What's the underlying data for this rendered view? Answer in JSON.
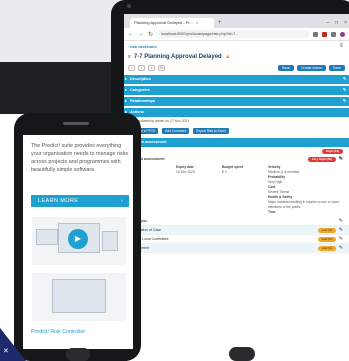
{
  "browser": {
    "tab_title": "Planning Approval Delayed - Pr...",
    "tab_close": "×",
    "new_tab": "+",
    "url": "localhost:8000/pro/lucas/page/risk.php?id=7..."
  },
  "app": {
    "logo": "risk decisions",
    "page_title": "7-7 Planning Approval Delayed",
    "toolbar_right": [
      "Save",
      "Create Action",
      "Save"
    ]
  },
  "sections": [
    "Description",
    "Categories",
    "Relationships",
    "Actions"
  ],
  "actions_text": "Last updated by admin on 17 Nov 2021",
  "action_buttons": [
    "Create a PPTX",
    "Add Comment",
    "Export Risk to Excel"
  ],
  "assessment": {
    "section_title": "Current assessment",
    "row1_label": "Risk",
    "row1_badge": "High (15)",
    "row2_label": "Current assessment",
    "row2_badge": "Very High (20)",
    "grid": {
      "col1_label": "Date",
      "col1_value": "2018",
      "col2_label": "Expiry date",
      "col2_value": "10 Dec 2023",
      "col3_label": "Budget spent",
      "col3_value": "$ 0",
      "col4_label": "Velocity",
      "col4_value": "Medium (1-6 months)",
      "col4_label2": "Probability",
      "col4_value2": "Very High",
      "col4_label3": "Cost",
      "col4_value3": "Severe Threat",
      "col4_label4": "Health & Safety",
      "col4_value4": "Major incident resulting in injuries to one or more members of the public",
      "col4_label5": "Time"
    }
  },
  "list": [
    {
      "label": "Target plan",
      "badge": ""
    },
    {
      "label": "Preparation of Case",
      "badge": "Low (4)"
    },
    {
      "label": "Update Local Committee",
      "badge": "Low (6)"
    },
    {
      "label": "Assessment",
      "badge": "Low (4)"
    }
  ],
  "phone": {
    "text": "The Predict! suite provides everything your organisation needs to manage risks across projects and programmes with beautifully simple software.",
    "learn_more": "LEARN MORE",
    "link": "Predict! Risk Controller"
  },
  "colors": {
    "accent": "#1ea0d0",
    "badge_red": "#e53935",
    "badge_orange": "#f5a623"
  }
}
